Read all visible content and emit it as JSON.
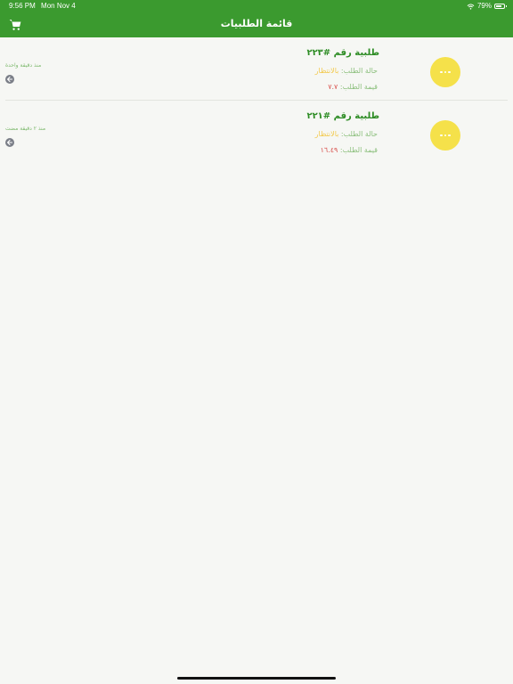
{
  "status_bar": {
    "time": "9:56 PM",
    "date": "Mon Nov 4",
    "battery": "79%",
    "battery_level": 0.79,
    "wifi_icon": "wifi-icon",
    "battery_icon": "battery-icon"
  },
  "header": {
    "title": "قائمة الطلبيات",
    "cart_icon": "cart-icon",
    "background": "#3b9a2f"
  },
  "labels": {
    "status": "حالة الطلب:",
    "value": "قيمة الطلب:"
  },
  "orders": [
    {
      "title": "طلبية رقم #٢٢٣",
      "status": "بالانتظار",
      "value": "٧.٧",
      "time_ago": "منذ دقيقة واحدة"
    },
    {
      "title": "طلبية رقم #٢٢١",
      "status": "بالانتظار",
      "value": "١٦.٤٩",
      "time_ago": "منذ ٢ دقيقة مضت"
    }
  ],
  "icons": {
    "more": "more-icon",
    "arrow": "arrow-left-circle-icon"
  },
  "colors": {
    "title_green": "#2d8c24",
    "status_yellow": "#f2c94c",
    "value_red": "#d9534f",
    "more_button": "#f5e14a"
  }
}
